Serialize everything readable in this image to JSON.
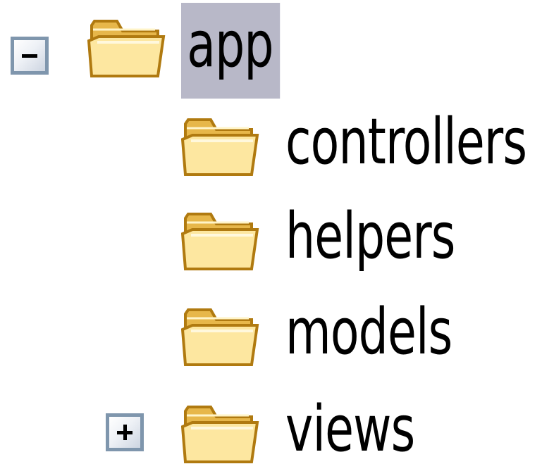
{
  "tree": {
    "root": {
      "label": "app",
      "expanded": true,
      "selected": true,
      "expander_symbol": "minus",
      "icon": "folder-icon",
      "children": [
        {
          "label": "controllers",
          "icon": "folder-icon"
        },
        {
          "label": "helpers",
          "icon": "folder-icon"
        },
        {
          "label": "models",
          "icon": "folder-icon"
        },
        {
          "label": "views",
          "icon": "folder-icon",
          "expander_symbol": "plus",
          "expanded": false
        }
      ]
    }
  },
  "colors": {
    "selection_background": "#b8b8c8",
    "expander_border": "#7f96ad",
    "folder_fill": "#fbe08a",
    "folder_outline": "#b07a10"
  }
}
